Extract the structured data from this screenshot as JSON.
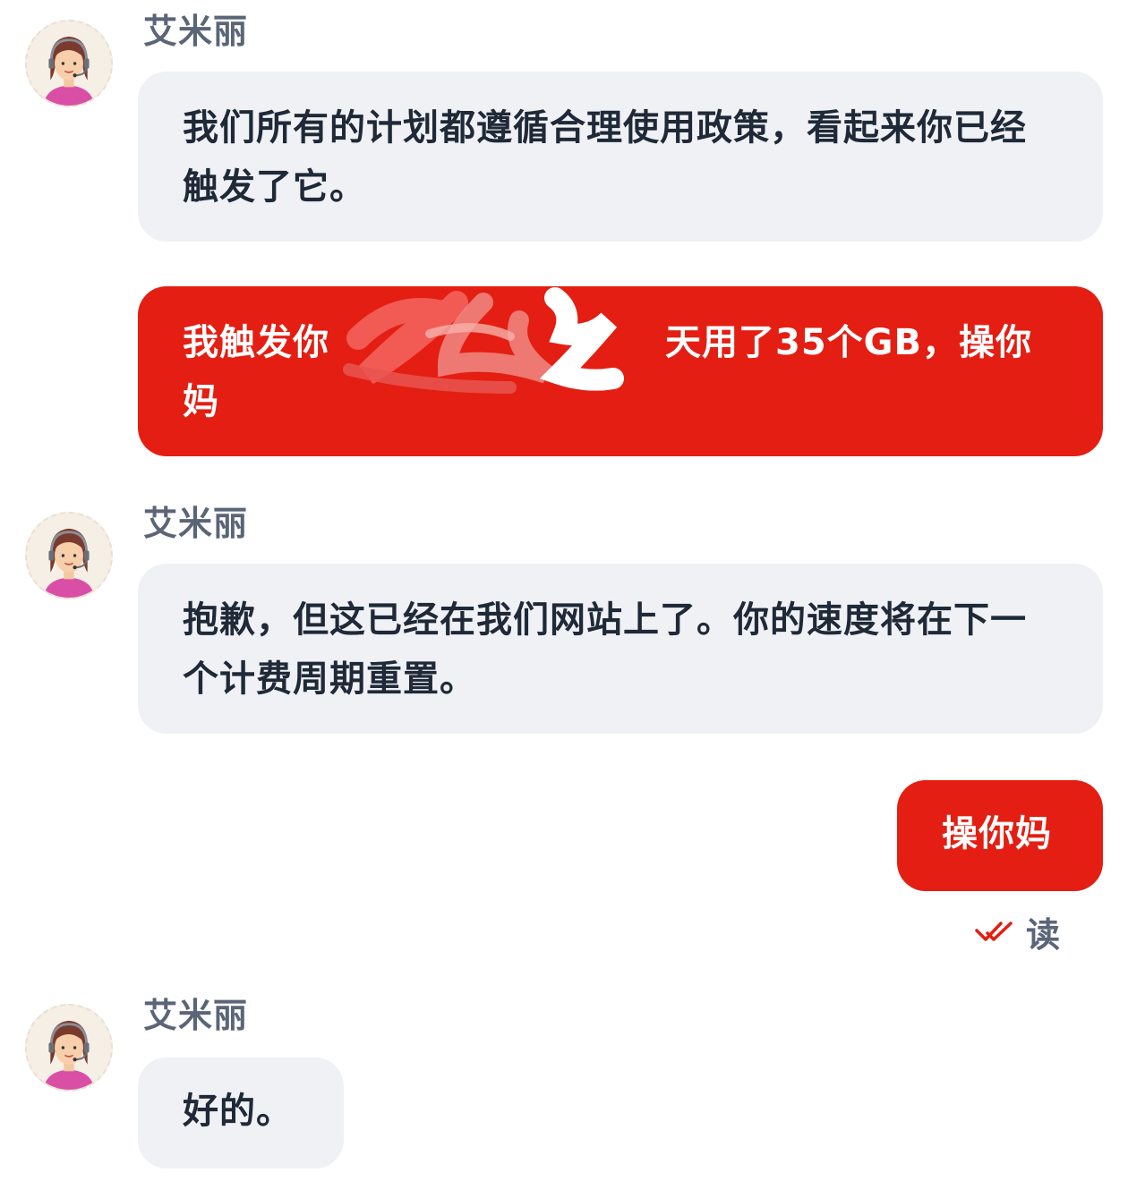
{
  "messages": [
    {
      "sender": "艾米丽",
      "text": "我们所有的计划都遵循合理使用政策，看起来你已经触发了它。"
    },
    {
      "text_start": "我触发你",
      "text_end": "天用了35个GB，操你妈"
    },
    {
      "sender": "艾米丽",
      "text": "抱歉，但这已经在我们网站上了。你的速度将在下一个计费周期重置。"
    },
    {
      "text": "操你妈",
      "status": "读"
    },
    {
      "sender": "艾米丽",
      "text": "好的。"
    }
  ],
  "icons": {
    "avatar": "agent-headset-avatar-icon",
    "read": "double-check-icon"
  },
  "colors": {
    "user_bubble": "#e41e12",
    "agent_bubble": "#eff1f5",
    "sender_name": "#5a6577",
    "agent_text": "#1f2937"
  }
}
